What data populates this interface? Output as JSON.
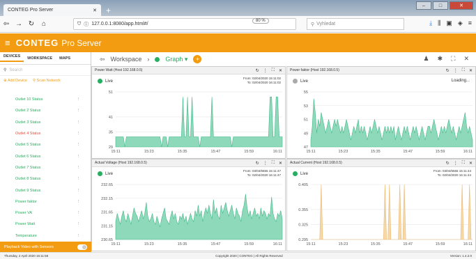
{
  "browser": {
    "tab_title": "CONTEG Pro Server",
    "url": "127.0.0.1:8080/app.html#/",
    "zoom": "80 %",
    "search_placeholder": "Vyhledat"
  },
  "app": {
    "logo": "CONTEG",
    "product": "Pro Server"
  },
  "sidebar": {
    "tabs": [
      "DEVICES",
      "WORKSPACE",
      "MAPS"
    ],
    "search_placeholder": "Search",
    "add_device": "Add Device",
    "scan_network": "Scan Network",
    "items": [
      {
        "label": "Outlet 10 Status",
        "alert": false
      },
      {
        "label": "Outlet 2 Status",
        "alert": false
      },
      {
        "label": "Outlet 3 Status",
        "alert": false
      },
      {
        "label": "Outlet 4 Status",
        "alert": true
      },
      {
        "label": "Outlet 5 Status",
        "alert": false
      },
      {
        "label": "Outlet 6 Status",
        "alert": false
      },
      {
        "label": "Outlet 7 Status",
        "alert": false
      },
      {
        "label": "Outlet 8 Status",
        "alert": false
      },
      {
        "label": "Outlet 9 Status",
        "alert": false
      },
      {
        "label": "Power faktor",
        "alert": false
      },
      {
        "label": "Power VA",
        "alert": false
      },
      {
        "label": "Power Watt",
        "alert": false
      },
      {
        "label": "Temperature",
        "alert": false
      }
    ],
    "playback": "Playback Video with Sensors"
  },
  "crumbs": {
    "workspace": "Workspace",
    "graph": "Graph"
  },
  "panels": [
    {
      "title": "Power Watt (Host 192.168.0.5)",
      "live": "Live",
      "from": "From: 02/04/2020 15:11:02",
      "to": "To: 02/04/2020 16:11:02",
      "loading": "",
      "color": "#8fd9bb",
      "stroke": "#45b98b",
      "ymin": 29,
      "ymax": 51,
      "yticks": [
        "51",
        "41",
        "35",
        "29"
      ],
      "xticks": [
        "15:11",
        "15:23",
        "15:35",
        "15:47",
        "15:59",
        "16:11"
      ],
      "values": [
        33,
        33,
        33,
        33,
        33,
        33,
        29,
        33,
        33,
        33,
        33,
        33,
        33,
        33,
        33,
        33,
        33,
        33,
        33,
        33,
        33,
        33,
        33,
        33,
        33,
        33,
        33,
        33,
        33,
        33,
        29,
        33,
        33,
        33,
        29,
        33,
        33,
        33,
        33,
        33,
        33,
        33,
        33,
        33,
        49,
        33,
        33,
        49,
        33,
        33,
        49,
        33,
        33,
        33,
        33,
        29,
        33,
        33,
        33,
        33,
        33,
        33,
        33,
        49,
        33,
        33,
        33,
        33,
        33,
        33,
        33,
        33,
        33,
        33,
        33,
        33,
        29,
        33,
        33,
        33,
        33,
        33,
        33,
        33,
        33,
        33,
        33,
        33,
        33,
        33,
        33,
        33,
        33,
        33,
        33,
        33,
        33,
        33,
        33,
        33,
        33,
        49,
        49,
        33,
        33,
        49,
        49,
        33,
        33,
        33
      ]
    },
    {
      "title": "Power faktor (Host 192.168.0.5)",
      "live": "Live",
      "from": "",
      "to": "",
      "loading": "Loading...",
      "color": "#8fd9bb",
      "stroke": "#45b98b",
      "ymin": 47,
      "ymax": 55,
      "yticks": [
        "55",
        "53",
        "51",
        "49",
        "47"
      ],
      "xticks": [
        "15:11",
        "15:23",
        "15:35",
        "15:47",
        "15:59",
        "16:11"
      ],
      "values": [
        48,
        50,
        54,
        52,
        49,
        51,
        50,
        52,
        51,
        50,
        49,
        50,
        51,
        50,
        49,
        50,
        51,
        50,
        51,
        50,
        49,
        50,
        49,
        50,
        51,
        50,
        49,
        48,
        49,
        50,
        49,
        50,
        51,
        49,
        50,
        49,
        50,
        49,
        48,
        49,
        50,
        49,
        50,
        51,
        50,
        49,
        50,
        49,
        48,
        49,
        50,
        49,
        50,
        49,
        50,
        49,
        50,
        48,
        49,
        50,
        49,
        48,
        49,
        50,
        49,
        50,
        49,
        48,
        49,
        50,
        49,
        50,
        49,
        48,
        49,
        50,
        49,
        48,
        49,
        50,
        50,
        49,
        50,
        51,
        50,
        49,
        48,
        49,
        50,
        49,
        50,
        49,
        50,
        51,
        50,
        49,
        50,
        49,
        48,
        49,
        50,
        49,
        50,
        51,
        52,
        50,
        49,
        50,
        49,
        48
      ]
    },
    {
      "title": "Actual Voltage (Host 192.168.0.5)",
      "live": "Live",
      "from": "From: 03/04/5555 15:11:47",
      "to": "To: 02/04/2020 16:11:47",
      "loading": "",
      "color": "#8fd9bb",
      "stroke": "#45b98b",
      "ymin": 230.65,
      "ymax": 232.65,
      "yticks": [
        "232.65",
        "232.15",
        "231.65",
        "231.15",
        "230.65"
      ],
      "xticks": [
        "15:11",
        "15:23",
        "15:35",
        "15:47",
        "15:59",
        "16:11"
      ],
      "values": [
        231.3,
        231.6,
        231.4,
        231.2,
        231.5,
        231.7,
        231.4,
        231.3,
        231.6,
        231.4,
        231.2,
        231.5,
        231.8,
        231.6,
        231.5,
        231.3,
        231.5,
        231.7,
        231.4,
        231.6,
        232.0,
        231.5,
        231.3,
        231.4,
        231.6,
        231.3,
        231.2,
        231.5,
        231.3,
        231.1,
        231.4,
        231.6,
        231.8,
        231.4,
        231.3,
        231.2,
        231.5,
        231.7,
        231.4,
        231.6,
        231.3,
        231.2,
        231.5,
        231.4,
        231.6,
        231.3,
        231.5,
        231.2,
        231.4,
        231.6,
        231.4,
        231.3,
        231.7,
        231.5,
        231.9,
        231.5,
        231.7,
        231.3,
        231.6,
        231.8,
        231.6,
        231.9,
        231.6,
        231.4,
        232.1,
        231.6,
        231.8,
        231.5,
        231.4,
        231.9,
        231.6,
        231.8,
        232.0,
        231.7,
        231.5,
        231.7,
        231.9,
        231.6,
        231.4,
        231.8,
        231.6,
        231.5,
        231.3,
        231.7,
        231.9,
        232.3,
        231.8,
        231.5,
        231.7,
        231.4,
        231.6,
        231.8,
        231.5,
        231.6,
        231.4,
        231.8,
        231.5,
        231.7,
        231.6,
        231.4,
        231.6,
        231.5,
        232.2,
        231.6,
        231.4,
        231.3,
        231.6,
        231.5,
        231.7,
        231.4
      ]
    },
    {
      "title": "Actual Current (Host 192.168.0.5)",
      "live": "Live",
      "from": "From: 03/04/5555 15:11:44",
      "to": "To: 02/04/2020 16:11:44",
      "loading": "",
      "color": "#f7d9a8",
      "stroke": "#e9b872",
      "ymin": 0.295,
      "ymax": 0.405,
      "yticks": [
        "0.405",
        "0.355",
        "0.325",
        "0.295"
      ],
      "xticks": [
        "15:11",
        "15:23",
        "15:35",
        "15:47",
        "15:59",
        "16:11"
      ],
      "values": [
        0.295,
        0.295,
        0.295,
        0.295,
        0.295,
        0.295,
        0.295,
        0.405,
        0.295,
        0.295,
        0.295,
        0.295,
        0.295,
        0.295,
        0.295,
        0.295,
        0.295,
        0.295,
        0.295,
        0.295,
        0.295,
        0.295,
        0.295,
        0.295,
        0.295,
        0.295,
        0.295,
        0.295,
        0.295,
        0.295,
        0.295,
        0.295,
        0.295,
        0.295,
        0.295,
        0.295,
        0.295,
        0.295,
        0.295,
        0.295,
        0.295,
        0.295,
        0.295,
        0.295,
        0.295,
        0.295,
        0.295,
        0.295,
        0.295,
        0.295,
        0.405,
        0.295,
        0.295,
        0.405,
        0.295,
        0.295,
        0.295,
        0.295,
        0.295,
        0.295,
        0.405,
        0.295,
        0.295,
        0.405,
        0.295,
        0.295,
        0.295,
        0.295,
        0.295,
        0.295,
        0.295,
        0.295,
        0.295,
        0.295,
        0.295,
        0.295,
        0.295,
        0.295,
        0.295,
        0.295,
        0.295,
        0.295,
        0.295,
        0.295,
        0.295,
        0.295,
        0.295,
        0.295,
        0.295,
        0.295,
        0.295,
        0.295,
        0.295,
        0.295,
        0.295,
        0.295,
        0.295,
        0.295,
        0.295,
        0.295,
        0.295,
        0.295,
        0.405,
        0.295,
        0.295,
        0.295,
        0.295,
        0.405,
        0.295,
        0.295
      ]
    }
  ],
  "footer": {
    "left": "Thursday, 2 April 2020 16:11:58",
    "center": "Copyright 2020 | CONTEG | All Rights Reserved",
    "right": "Version: 1.4.2.0"
  }
}
